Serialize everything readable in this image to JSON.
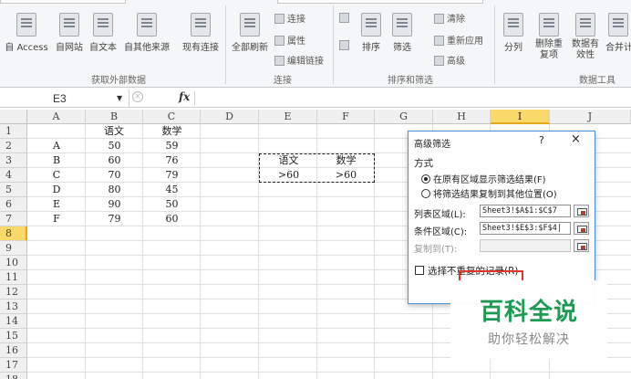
{
  "ribbon": {
    "external_buttons": [
      "自 Access",
      "自网站",
      "自文本",
      "自其他来源",
      "现有连接"
    ],
    "external_group": "获取外部数据",
    "refresh_all": "全部刷新",
    "connections_items": [
      "连接",
      "属性",
      "编辑链接"
    ],
    "connections_group": "连接",
    "sort_label": "排序",
    "filter_label": "筛选",
    "sortfilter_items": [
      "清除",
      "重新应用",
      "高级"
    ],
    "sortfilter_group": "排序和筛选",
    "data_tools": [
      "分列",
      "删除重复项",
      "数据有效性",
      "合并计"
    ],
    "data_tools_group": "数据工具"
  },
  "formula_bar": {
    "name_box": "E3",
    "fx": "fx",
    "cancel": "×"
  },
  "sheet": {
    "columns": [
      "A",
      "B",
      "C",
      "D",
      "E",
      "F",
      "G",
      "H",
      "I",
      "J"
    ],
    "selected_column": "I",
    "rows": [
      "1",
      "2",
      "3",
      "4",
      "5",
      "6",
      "7",
      "8",
      "9",
      "10",
      "11",
      "12",
      "13",
      "14",
      "15",
      "16",
      "17",
      "18"
    ],
    "selected_row": "8",
    "header_row": {
      "B": "语文",
      "C": "数学"
    },
    "records": [
      {
        "A": "A",
        "B": "50",
        "C": "59"
      },
      {
        "A": "B",
        "B": "60",
        "C": "76"
      },
      {
        "A": "C",
        "B": "70",
        "C": "79"
      },
      {
        "A": "D",
        "B": "80",
        "C": "45"
      },
      {
        "A": "E",
        "B": "90",
        "C": "50"
      },
      {
        "A": "F",
        "B": "79",
        "C": "60"
      }
    ],
    "criteria": {
      "E3": "语文",
      "F3": "数学",
      "E4": ">60",
      "F4": ">60"
    }
  },
  "dialog": {
    "title": "高级筛选",
    "help": "?",
    "close": "×",
    "method_label": "方式",
    "radio1": "在原有区域显示筛选结果(F)",
    "radio2": "将筛选结果复制到其他位置(O)",
    "list_range_label": "列表区域(L):",
    "list_range_value": "Sheet3!$A$1:$C$7",
    "criteria_range_label": "条件区域(C):",
    "criteria_range_value": "Sheet3!$E$3:$F$4|",
    "copy_to_label": "复制到(T):",
    "copy_to_value": "",
    "unique_label": "选择不重复的记录(R)"
  },
  "watermark": {
    "logo": "百科全说",
    "subtitle": "助你轻松解决"
  }
}
